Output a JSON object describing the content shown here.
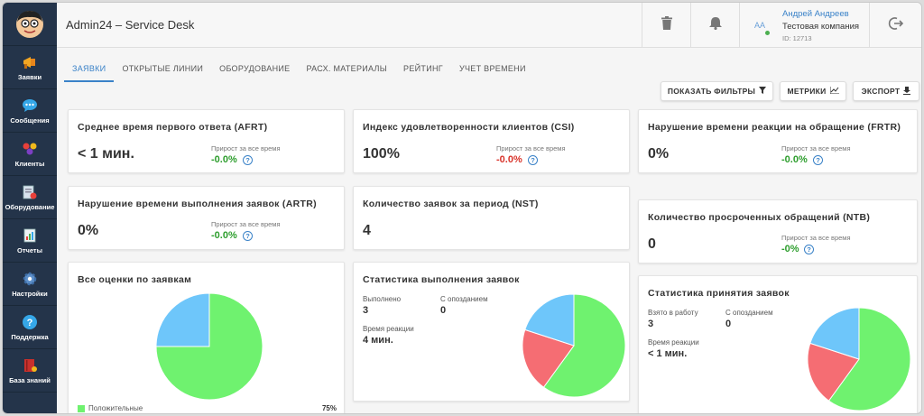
{
  "app": {
    "title": "Admin24 – Service Desk"
  },
  "sidebar": {
    "items": [
      {
        "label": "Заявки",
        "icon": "megaphone-icon"
      },
      {
        "label": "Сообщения",
        "icon": "chat-icon"
      },
      {
        "label": "Клиенты",
        "icon": "clients-icon"
      },
      {
        "label": "Оборудование",
        "icon": "equipment-icon"
      },
      {
        "label": "Отчеты",
        "icon": "report-icon"
      },
      {
        "label": "Настройки",
        "icon": "gear-icon"
      },
      {
        "label": "Поддержка",
        "icon": "help-icon"
      },
      {
        "label": "База знаний",
        "icon": "book-icon"
      }
    ]
  },
  "header": {
    "user": {
      "initials": "AA",
      "name": "Андрей Андреев",
      "company": "Тестовая компания",
      "id": "ID: 12713"
    }
  },
  "tabs": [
    "ЗАЯВКИ",
    "ОТКРЫТЫЕ ЛИНИИ",
    "ОБОРУДОВАНИЕ",
    "РАСХ. МАТЕРИАЛЫ",
    "РЕЙТИНГ",
    "УЧЕТ ВРЕМЕНИ"
  ],
  "toolbar": {
    "filters": "ПОКАЗАТЬ ФИЛЬТРЫ",
    "metrics": "МЕТРИКИ",
    "export": "ЭКСПОРТ"
  },
  "growth_label": "Прирост за все время",
  "help_glyph": "?",
  "metrics": {
    "afrt": {
      "title": "Среднее время первого ответа (AFRT)",
      "value": "< 1 мин.",
      "growth": "-0.0%",
      "growth_color": "#2e9e2e"
    },
    "csi": {
      "title": "Индекс удовлетворенности клиентов (CSI)",
      "value": "100%",
      "growth": "-0.0%",
      "growth_color": "#d9342b"
    },
    "frtr": {
      "title": "Нарушение времени реакции на обращение (FRTR)",
      "value": "0%",
      "growth": "-0.0%",
      "growth_color": "#2e9e2e"
    },
    "artr": {
      "title": "Нарушение времени выполнения заявок (ARTR)",
      "value": "0%",
      "growth": "-0.0%",
      "growth_color": "#2e9e2e"
    },
    "nst": {
      "title": "Количество заявок за период (NST)",
      "value": "4"
    },
    "ntb": {
      "title": "Количество просроченных обращений (NTB)",
      "value": "0",
      "growth": "-0%",
      "growth_color": "#2e9e2e"
    }
  },
  "ratings": {
    "title": "Все оценки по заявкам",
    "legend_label": "Положительные",
    "legend_value": "75%"
  },
  "completion": {
    "title": "Статистика выполнения заявок",
    "done_label": "Выполнено",
    "done_value": "3",
    "late_label": "С опозданием",
    "late_value": "0",
    "reaction_label": "Время реакции",
    "reaction_value": "4 мин."
  },
  "acceptance": {
    "title": "Статистика принятия заявок",
    "taken_label": "Взято в работу",
    "taken_value": "3",
    "late_label": "С опозданием",
    "late_value": "0",
    "reaction_label": "Время реакции",
    "reaction_value": "< 1 мин."
  },
  "chart_data": [
    {
      "type": "pie",
      "name": "ratings",
      "values": [
        75,
        25
      ],
      "colors": [
        "#6ff26f",
        "#6ec6fa"
      ]
    },
    {
      "type": "pie",
      "name": "completion",
      "values": [
        60,
        20,
        20
      ],
      "colors": [
        "#6ff26f",
        "#f56d73",
        "#6ec6fa"
      ]
    },
    {
      "type": "pie",
      "name": "acceptance",
      "values": [
        60,
        20,
        20
      ],
      "colors": [
        "#6ff26f",
        "#f56d73",
        "#6ec6fa"
      ]
    }
  ]
}
